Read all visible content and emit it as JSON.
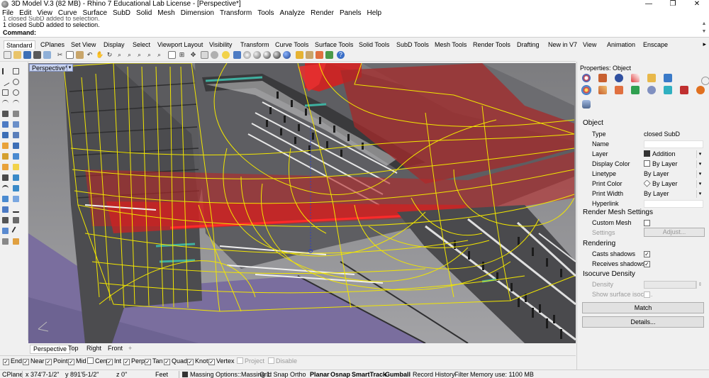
{
  "titlebar": {
    "title": "3D Model V.3 (82 MB) - Rhino 7 Educational Lab License - [Perspective*]",
    "minimize": "—",
    "maximize": "❐",
    "close": "✕"
  },
  "menu": [
    "File",
    "Edit",
    "View",
    "Curve",
    "Surface",
    "SubD",
    "Solid",
    "Mesh",
    "Dimension",
    "Transform",
    "Tools",
    "Analyze",
    "Render",
    "Panels",
    "Help"
  ],
  "command": {
    "history_prev": "1 closed SubD added to selection.",
    "history_last": "1 closed SubD added to selection.",
    "prompt": "Command:",
    "value": ""
  },
  "tabs": [
    "Standard",
    "CPlanes",
    "Set View",
    "Display",
    "Select",
    "Viewport Layout",
    "Visibility",
    "Transform",
    "Curve Tools",
    "Surface Tools",
    "Solid Tools",
    "SubD Tools",
    "Mesh Tools",
    "Render Tools",
    "Drafting",
    "New in V7",
    "View",
    "Animation",
    "Enscape"
  ],
  "tabs_more": "▸",
  "viewport": {
    "label": "Perspective*",
    "dropdown": "▾"
  },
  "viewport_tabs": [
    "Perspective",
    "Top",
    "Right",
    "Front",
    "+"
  ],
  "osnaps": [
    {
      "label": "End",
      "checked": true,
      "enabled": true
    },
    {
      "label": "Near",
      "checked": true,
      "enabled": true
    },
    {
      "label": "Point",
      "checked": true,
      "enabled": true
    },
    {
      "label": "Mid",
      "checked": true,
      "enabled": true
    },
    {
      "label": "Cen",
      "checked": false,
      "enabled": true
    },
    {
      "label": "Int",
      "checked": true,
      "enabled": true
    },
    {
      "label": "Perp",
      "checked": true,
      "enabled": true
    },
    {
      "label": "Tan",
      "checked": true,
      "enabled": true
    },
    {
      "label": "Quad",
      "checked": true,
      "enabled": true
    },
    {
      "label": "Knot",
      "checked": true,
      "enabled": true
    },
    {
      "label": "Vertex",
      "checked": true,
      "enabled": true
    },
    {
      "label": "Project",
      "checked": false,
      "enabled": false
    },
    {
      "label": "Disable",
      "checked": false,
      "enabled": false
    }
  ],
  "status": {
    "cplane": "CPlane",
    "x": "x 374'7-1/2\"",
    "y": "y 891'5-1/2\"",
    "z": "z 0\"",
    "units": "Feet",
    "layer": "Massing Options::Massing 1:",
    "grid_snap": "Grid Snap",
    "ortho": "Ortho",
    "planar": "Planar",
    "osnap": "Osnap",
    "smarttrack": "SmartTrack",
    "gumball": "Gumball",
    "record_history": "Record History",
    "filter": "Filter",
    "memory": "Memory use: 1100 MB"
  },
  "properties": {
    "title": "Properties: Object",
    "section_object": "Object",
    "rows": [
      {
        "label": "Type",
        "value": "closed SubD"
      },
      {
        "label": "Name",
        "value": ""
      },
      {
        "label": "Layer",
        "value": "Addition"
      },
      {
        "label": "Display Color",
        "value": "By Layer"
      },
      {
        "label": "Linetype",
        "value": "By Layer"
      },
      {
        "label": "Print Color",
        "value": "By Layer"
      },
      {
        "label": "Print Width",
        "value": "By Layer"
      },
      {
        "label": "Hyperlink",
        "value": ""
      }
    ],
    "section_rendermesh": "Render Mesh Settings",
    "custom_mesh": "Custom Mesh",
    "settings": "Settings",
    "adjust": "Adjust...",
    "section_rendering": "Rendering",
    "casts_shadows": "Casts shadows",
    "receives_shadows": "Receives shadows",
    "section_isocurve": "Isocurve Density",
    "density": "Density",
    "show_isocurves": "Show surface isocu...",
    "match_button": "Match",
    "details_button": "Details...",
    "check_mark": "✓",
    "dropdown_arrow": "▾",
    "spin_arrow": "⇕",
    "layer_color": "#333333"
  },
  "colors": {
    "wireframe": "#f2e600",
    "red_surface": "#d42020",
    "ground": "#7a6e9e",
    "teal": "#3fb0a0"
  }
}
